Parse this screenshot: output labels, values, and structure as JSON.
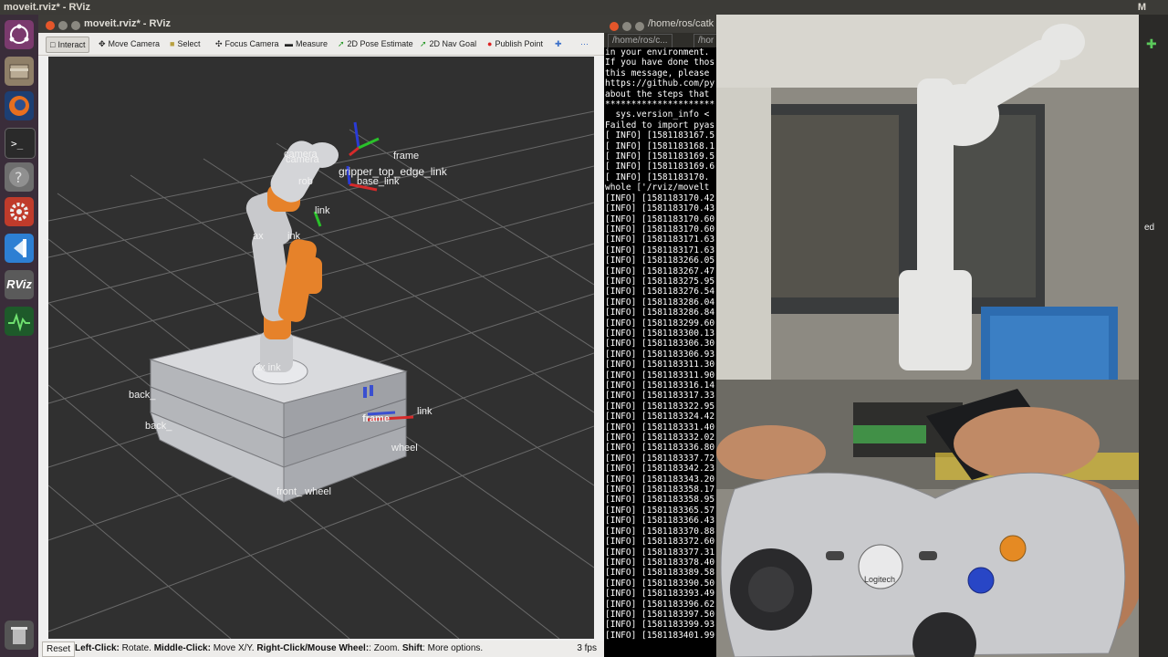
{
  "top_bar": {
    "title": "moveit.rviz* - RViz",
    "right_text": "M"
  },
  "launcher": {
    "items": [
      {
        "name": "ubuntu-dash-icon",
        "color": "#7b3a6e"
      },
      {
        "name": "files-icon",
        "color": "#8f7f68"
      },
      {
        "name": "firefox-icon",
        "color": "#e76f1f"
      },
      {
        "name": "terminal-icon",
        "color": "#2a2a2a"
      },
      {
        "name": "help-icon",
        "color": "#6e6e6e"
      },
      {
        "name": "settings-icon",
        "color": "#c03b2b"
      },
      {
        "name": "vscode-icon",
        "color": "#2d7fd3"
      },
      {
        "name": "rviz-icon",
        "color": "#5a5a5a"
      },
      {
        "name": "system-monitor-icon",
        "color": "#2d8a3e"
      },
      {
        "name": "trash-icon",
        "color": "#777777"
      }
    ],
    "rviz_text": "RViz"
  },
  "rviz": {
    "window_title": "moveit.rviz* - RViz",
    "tools": [
      {
        "label": "Interact",
        "icon": "interact-icon",
        "active": true
      },
      {
        "label": "Move Camera",
        "icon": "move-camera-icon"
      },
      {
        "label": "Select",
        "icon": "select-icon"
      },
      {
        "label": "Focus Camera",
        "icon": "focus-camera-icon"
      },
      {
        "label": "Measure",
        "icon": "measure-icon"
      },
      {
        "label": "2D Pose Estimate",
        "icon": "pose-estimate-icon"
      },
      {
        "label": "2D Nav Goal",
        "icon": "nav-goal-icon"
      },
      {
        "label": "Publish Point",
        "icon": "publish-point-icon"
      }
    ],
    "frame_labels": {
      "gripper": "gripper_top_edge_link",
      "base_link": "base_link",
      "link_a": "link",
      "axis_link": "ax",
      "axis_link2": "ink",
      "robot": "rob",
      "camera": "camera",
      "camera2": "camera",
      "frame_top": "frame",
      "base_link_low": "ax    ink",
      "back1": "back_",
      "back2": "back_",
      "frame_side": "frame",
      "link_side": "link",
      "wheel_side": "wheel",
      "front_wheel": "front_    wheel"
    },
    "status": {
      "reset_label": "Reset",
      "hint_left_click": "Left-Click:",
      "hint_rotate": " Rotate. ",
      "hint_middle": "Middle-Click:",
      "hint_move": " Move X/Y. ",
      "hint_right": "Right-Click/Mouse Wheel:",
      "hint_zoom": ": Zoom. ",
      "hint_shift": "Shift",
      "hint_more": ": More options.",
      "fps": "3 fps"
    }
  },
  "terminal": {
    "title": "/home/ros/catk",
    "tabs": [
      "/home/ros/c...",
      "/hor"
    ],
    "lines": [
      "in your environment.",
      "If you have done thos",
      "this message, please",
      "https://github.com/py",
      "about the steps that",
      "*********************",
      "  sys.version_info <",
      "Failed to import pyas",
      "[ INFO] [1581183167.5",
      "[ INFO] [1581183168.1",
      "[ INFO] [1581183169.5",
      "[ INFO] [1581183169.6",
      "[ INFO] [1581183170.",
      "whole ['/rviz/movelt",
      "[INFO] [1581183170.42",
      "[INFO] [1581183170.43",
      "[INFO] [1581183170.60",
      "[INFO] [1581183170.60",
      "[INFO] [1581183171.63",
      "[INFO] [1581183171.63",
      "[INFO] [1581183266.05",
      "[INFO] [1581183267.47",
      "[INFO] [1581183275.95",
      "[INFO] [1581183276.54",
      "[INFO] [1581183286.04",
      "[INFO] [1581183286.84",
      "[INFO] [1581183299.60",
      "[INFO] [1581183300.13",
      "[INFO] [1581183306.30",
      "[INFO] [1581183306.93",
      "[INFO] [1581183311.30",
      "[INFO] [1581183311.90",
      "[INFO] [1581183316.14",
      "[INFO] [1581183317.33",
      "[INFO] [1581183322.95",
      "[INFO] [1581183324.42",
      "[INFO] [1581183331.40",
      "[INFO] [1581183332.02",
      "[INFO] [1581183336.80",
      "[INFO] [1581183337.72",
      "[INFO] [1581183342.23",
      "[INFO] [1581183343.20",
      "[INFO] [1581183358.17",
      "[INFO] [1581183358.95",
      "[INFO] [1581183365.57",
      "[INFO] [1581183366.43",
      "[INFO] [1581183370.88",
      "[INFO] [1581183372.60",
      "[INFO] [1581183377.31",
      "[INFO] [1581183378.40",
      "[INFO] [1581183389.58",
      "[INFO] [1581183390.50",
      "[INFO] [1581183393.49",
      "[INFO] [1581183396.62",
      "[INFO] [1581183397.50",
      "[INFO] [1581183399.93",
      "[INFO] [1581183401.99"
    ]
  },
  "photo": {
    "gamepad_brand": "Logitech",
    "edge_text": "ed"
  },
  "colors": {
    "desktop": "#2c001e",
    "panel": "#3c3b37",
    "viewport": "#303030",
    "robot_orange": "#e6822a",
    "robot_grey": "#c8c9cc",
    "terminal_bg": "#000000"
  }
}
